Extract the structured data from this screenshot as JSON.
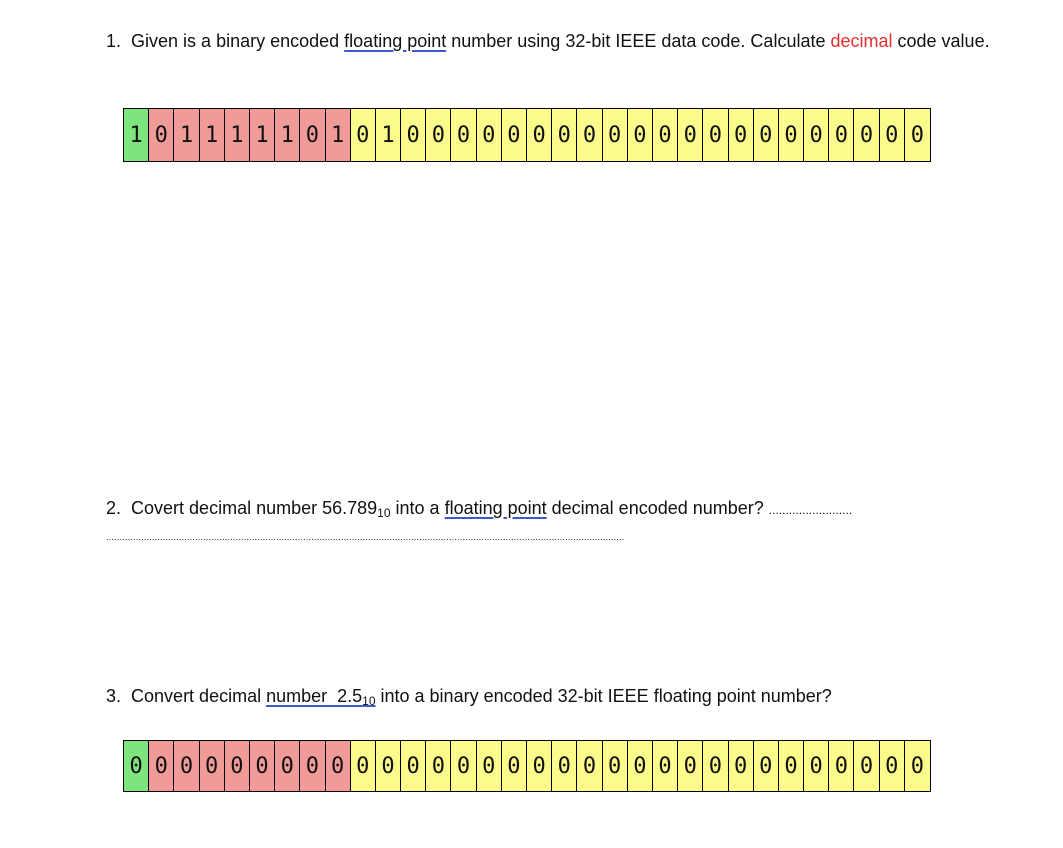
{
  "question1": {
    "number": "1.",
    "text_before": "Given is a binary encoded ",
    "underlined": "floating point",
    "text_middle": " number using 32-bit IEEE data code. Calculate ",
    "highlight": "decimal",
    "text_after": " code value.",
    "bits": [
      "1",
      "0",
      "1",
      "1",
      "1",
      "1",
      "1",
      "0",
      "1",
      "0",
      "1",
      "0",
      "0",
      "0",
      "0",
      "0",
      "0",
      "0",
      "0",
      "0",
      "0",
      "0",
      "0",
      "0",
      "0",
      "0",
      "0",
      "0",
      "0",
      "0",
      "0",
      "0"
    ]
  },
  "question2": {
    "number": "2.",
    "text_before": "Covert decimal number 56.789",
    "subscript": "10",
    "text_middle": " into a ",
    "underlined": "floating point",
    "text_after": " decimal encoded number? ",
    "dots_inline": ".........................",
    "dots_line": "................................................................................................................................................................................................"
  },
  "question3": {
    "number": "3.",
    "text_before": "Convert decimal ",
    "underlined": "number  2.5",
    "subscript": "10",
    "text_after": " into a binary encoded 32-bit IEEE floating point number?",
    "bits": [
      "0",
      "0",
      "0",
      "0",
      "0",
      "0",
      "0",
      "0",
      "0",
      "0",
      "0",
      "0",
      "0",
      "0",
      "0",
      "0",
      "0",
      "0",
      "0",
      "0",
      "0",
      "0",
      "0",
      "0",
      "0",
      "0",
      "0",
      "0",
      "0",
      "0",
      "0",
      "0"
    ]
  },
  "colors": {
    "sign": "#7ee47e",
    "exponent": "#f09b98",
    "mantissa": "#fbfb8c",
    "highlight": "#e03030",
    "underline": "#3b5bcc"
  }
}
